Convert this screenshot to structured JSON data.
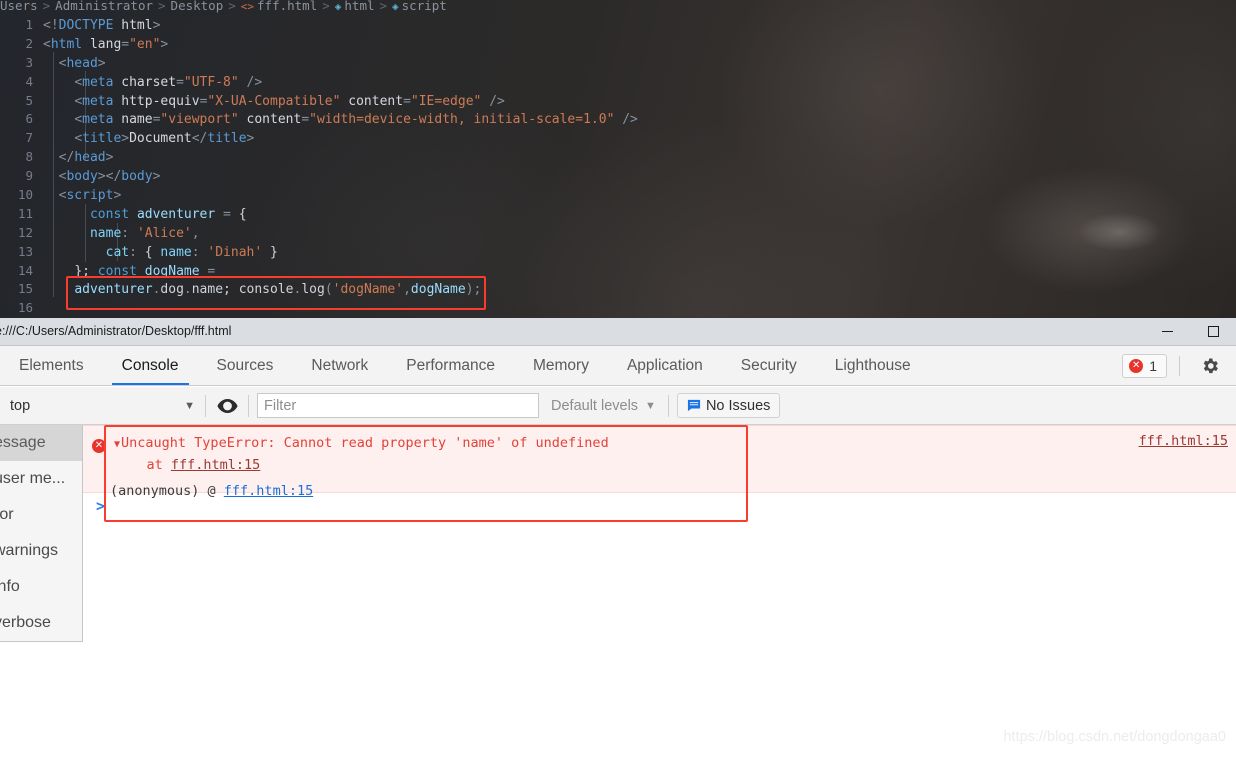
{
  "editor": {
    "breadcrumb": [
      {
        "label": "Users",
        "icon": ""
      },
      {
        "label": "Administrator",
        "icon": ""
      },
      {
        "label": "Desktop",
        "icon": ""
      },
      {
        "label": "fff.html",
        "icon": "html-file-icon"
      },
      {
        "label": "html",
        "icon": "tag-icon"
      },
      {
        "label": "script",
        "icon": "tag-icon"
      }
    ],
    "lines": [
      {
        "n": "1",
        "text": "<!DOCTYPE html>"
      },
      {
        "n": "2",
        "text": "<html lang=\"en\">"
      },
      {
        "n": "3",
        "text": "  <head>"
      },
      {
        "n": "4",
        "text": "    <meta charset=\"UTF-8\" />"
      },
      {
        "n": "5",
        "text": "    <meta http-equiv=\"X-UA-Compatible\" content=\"IE=edge\" />"
      },
      {
        "n": "6",
        "text": "    <meta name=\"viewport\" content=\"width=device-width, initial-scale=1.0\" />"
      },
      {
        "n": "7",
        "text": "    <title>Document</title>"
      },
      {
        "n": "8",
        "text": "  </head>"
      },
      {
        "n": "9",
        "text": "  <body></body>"
      },
      {
        "n": "10",
        "text": "  <script>"
      },
      {
        "n": "11",
        "text": "      const adventurer = {"
      },
      {
        "n": "12",
        "text": "      name: 'Alice',"
      },
      {
        "n": "13",
        "text": "        cat: { name: 'Dinah' }"
      },
      {
        "n": "14",
        "text": "    }; const dogName ="
      },
      {
        "n": "15",
        "text": "    adventurer.dog.name; console.log('dogName',dogName);"
      },
      {
        "n": "16",
        "text": ""
      }
    ],
    "highlighted_line": "15"
  },
  "urlbar": {
    "url": "e:///C:/Users/Administrator/Desktop/fff.html",
    "minimize_label": "minimize-icon",
    "maximize_label": "maximize-icon"
  },
  "devtools": {
    "tabs": [
      {
        "label": "Elements",
        "active": false
      },
      {
        "label": "Console",
        "active": true
      },
      {
        "label": "Sources",
        "active": false
      },
      {
        "label": "Network",
        "active": false
      },
      {
        "label": "Performance",
        "active": false
      },
      {
        "label": "Memory",
        "active": false
      },
      {
        "label": "Application",
        "active": false
      },
      {
        "label": "Security",
        "active": false
      },
      {
        "label": "Lighthouse",
        "active": false
      }
    ],
    "error_badge": {
      "icon": "✕",
      "count": "1"
    },
    "settings_icon": "gear-icon"
  },
  "filterbar": {
    "context": "top",
    "context_caret": "▼",
    "eye_icon": "eye-icon",
    "filter_placeholder": "Filter",
    "filter_value": "",
    "levels": "Default levels",
    "levels_caret": "▼",
    "issues_icon": "message-icon",
    "issues_label": "No Issues"
  },
  "console": {
    "error": {
      "caret": "▼",
      "icon": "✕",
      "message": "Uncaught TypeError: Cannot read property 'name' of undefined",
      "at_prefix": "    at ",
      "at_link": "fff.html:15",
      "stack_prefix": "(anonymous) @ ",
      "stack_link": "fff.html:15",
      "source_link": "fff.html:15"
    },
    "prompt_caret": ">"
  },
  "level_menu": {
    "items": [
      {
        "label": "essage",
        "selected": true
      },
      {
        "label": "user me...",
        "selected": false
      },
      {
        "label": "ror",
        "selected": false
      },
      {
        "label": "warnings",
        "selected": false
      },
      {
        "label": "info",
        "selected": false
      },
      {
        "label": "verbose",
        "selected": false
      }
    ]
  },
  "watermark": "https://blog.csdn.net/dongdongaa0",
  "colors": {
    "accent": "#1a73e8",
    "error": "#e8342a",
    "annotation": "#fa3c2e",
    "editor_bg": "#22252b"
  }
}
